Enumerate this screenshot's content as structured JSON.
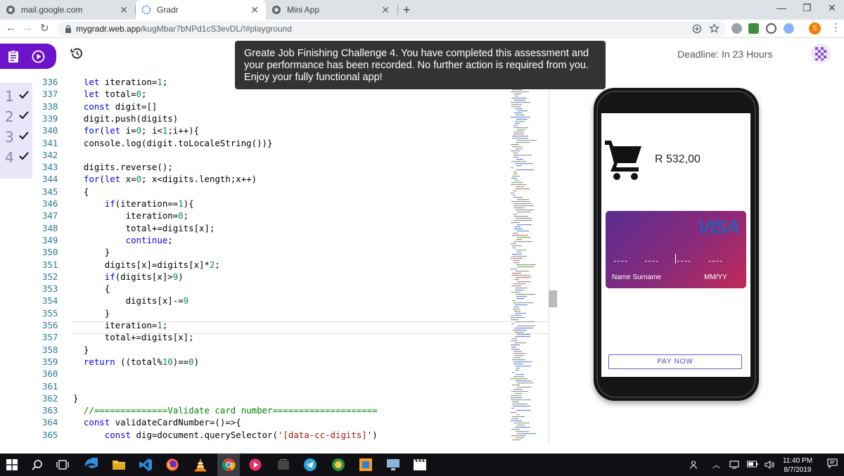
{
  "browser": {
    "tabs": [
      {
        "title": "mail.google.com"
      },
      {
        "title": "Gradr"
      },
      {
        "title": "Mini App"
      }
    ],
    "url_host": "mygradr.web.app",
    "url_path": "/kugMbar7bNPd1cS3evDL/!#playground",
    "profile_initial": "S"
  },
  "app": {
    "deadline": "Deadline: In 23 Hours",
    "checks": [
      "1",
      "2",
      "3",
      "4"
    ],
    "toast": "Greate Job Finishing Challenge 4. You have completed this assessment and your performance has been recorded. No further action is required from you. Enjoy your fully functional app!"
  },
  "code": [
    {
      "n": "336",
      "t": "  let iteration=1;"
    },
    {
      "n": "337",
      "t": "  let total=0;"
    },
    {
      "n": "338",
      "t": "  const digit=[]"
    },
    {
      "n": "339",
      "t": "  digit.push(digits)"
    },
    {
      "n": "340",
      "t": "  for(let i=0; i<1;i++){"
    },
    {
      "n": "341",
      "t": "  console.log(digit.toLocaleString())}"
    },
    {
      "n": "342",
      "t": ""
    },
    {
      "n": "343",
      "t": "  digits.reverse();"
    },
    {
      "n": "344",
      "t": "  for(let x=0; x<digits.length;x++)"
    },
    {
      "n": "345",
      "t": "  {"
    },
    {
      "n": "346",
      "t": "      if(iteration==1){"
    },
    {
      "n": "347",
      "t": "          iteration=0;"
    },
    {
      "n": "348",
      "t": "          total+=digits[x];"
    },
    {
      "n": "349",
      "t": "          continue;"
    },
    {
      "n": "350",
      "t": "      }"
    },
    {
      "n": "351",
      "t": "      digits[x]=digits[x]*2;"
    },
    {
      "n": "352",
      "t": "      if(digits[x]>9)"
    },
    {
      "n": "353",
      "t": "      {"
    },
    {
      "n": "354",
      "t": "          digits[x]-=9"
    },
    {
      "n": "355",
      "t": "      }"
    },
    {
      "n": "356",
      "t": "      iteration=1;"
    },
    {
      "n": "357",
      "t": "      total+=digits[x];"
    },
    {
      "n": "358",
      "t": "  }"
    },
    {
      "n": "359",
      "t": "  return ((total%10)==0)"
    },
    {
      "n": "360",
      "t": ""
    },
    {
      "n": "361",
      "t": ""
    },
    {
      "n": "362",
      "t": "}"
    },
    {
      "n": "363",
      "t": "  //==============Validate card number===================="
    },
    {
      "n": "364",
      "t": "  const validateCardNumber=()=>{"
    },
    {
      "n": "365",
      "t": "      const dig=document.querySelector('[data-cc-digits]')"
    }
  ],
  "mini_app": {
    "total": "R 532,00",
    "card_brand": "VISA",
    "digit_groups": [
      "----",
      "----",
      "----",
      "----"
    ],
    "card_name": "Name Surname",
    "card_expiry": "MM/YY",
    "pay_label": "PAY NOW"
  },
  "taskbar": {
    "time": "11:40 PM",
    "date": "8/7/2019"
  },
  "colors": {
    "accent": "#6b14c9",
    "toast_bg": "#333333",
    "line_number": "#2b7a96"
  }
}
